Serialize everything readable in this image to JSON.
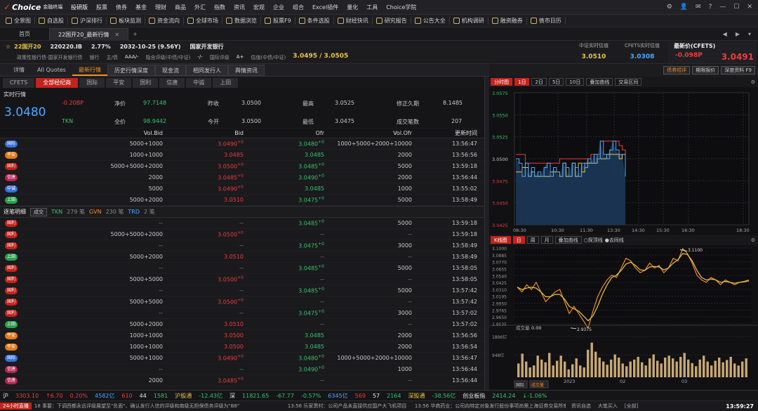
{
  "app": {
    "logo_mark": "✓",
    "logo_text": "Choice",
    "logo_sub": "金融终端",
    "edition": "投研版"
  },
  "menu": [
    "股票",
    "债券",
    "基金",
    "理财",
    "商品",
    "外汇",
    "指数",
    "资讯",
    "宏观",
    "企业",
    "组合",
    "Excel插件",
    "量化",
    "工具",
    "Choice学院"
  ],
  "toolbar": [
    "全景图",
    "自选股",
    "沪深排行",
    "板块监测",
    "资金流向",
    "全球市场",
    "数据浏览",
    "股票F9",
    "条件选股",
    "财经快讯",
    "研究报告",
    "公告大全",
    "机构调研",
    "融资融券",
    "债市日历"
  ],
  "tabs": {
    "home": "首页",
    "active": "22国开20_最新行情"
  },
  "bond": {
    "name": "22国开20",
    "code": "220220.IB",
    "coupon": "2.77%",
    "maturity": "2032-10-25 (9.56Y)",
    "issuer": "国家开发银行",
    "attr1": "政策性银行债-国家开发银行债",
    "attr2": "银行",
    "attr3": "主/债",
    "attr4": "AAA/-",
    "attr5": "隐含评级(中债/中证)",
    "attr6": "-/-",
    "attr7": "国际评级",
    "attr8": "A+",
    "val_label": "估值(中债/中证)",
    "val": "3.0495 / 3.0505"
  },
  "quotes": [
    {
      "label": "中证实时估值",
      "value": "3.0510"
    },
    {
      "label": "CFETS实时估值",
      "value": "3.0308"
    },
    {
      "label": "最新价(CFETS)",
      "value": "-0.098P",
      "value2": "3.0491"
    }
  ],
  "subtabs": [
    "详情",
    "All Quotes",
    "最新行情",
    "历史行情深度",
    "现金流",
    "相同发行人",
    "舆情资讯"
  ],
  "rightbtns": [
    "债券短评",
    "期限报价",
    "深度资料 F9"
  ],
  "sources": [
    "CFETS",
    "全部经纪商",
    "国际",
    "平安",
    "国利",
    "信唐",
    "中诚",
    "上田"
  ],
  "live": {
    "label": "实时行情",
    "last": "3.0480",
    "chg": "-0.20BP",
    "tkn": "TKN",
    "kv": [
      {
        "k": "净价",
        "v": "97.7148"
      },
      {
        "k": "昨收",
        "v": "3.0500"
      },
      {
        "k": "最高",
        "v": "3.0525"
      },
      {
        "k": "修正久期",
        "v": "8.1485"
      },
      {
        "k": "全价",
        "v": "98.9442"
      },
      {
        "k": "今开",
        "v": "3.0500"
      },
      {
        "k": "最低",
        "v": "3.0475"
      },
      {
        "k": "成交笔数",
        "v": "207"
      }
    ]
  },
  "book_cols": [
    "Vol.Bid",
    "Bid",
    "Ofr",
    "Vol.Ofr",
    "更新时间"
  ],
  "book": [
    {
      "src": "国际",
      "vb": "5000+1000",
      "b": "3.0490",
      "bc": "+0",
      "o": "3.0480",
      "oc": "+0",
      "vo": "1000+5000+2000+10000",
      "t": "13:56:47",
      "color": "#3a6fd8"
    },
    {
      "src": "平安",
      "vb": "1000+1000",
      "b": "3.0485",
      "bc": "",
      "o": "3.0485",
      "oc": "",
      "vo": "2000",
      "t": "13:56:56",
      "color": "#e07b1c"
    },
    {
      "src": "国利",
      "vb": "5000+5000+2000",
      "b": "3.0500",
      "bc": "+0",
      "o": "3.0485",
      "oc": "+0",
      "vo": "5000",
      "t": "13:59:18",
      "color": "#c2231b"
    },
    {
      "src": "信唐",
      "vb": "2000",
      "b": "3.0485",
      "bc": "+0",
      "o": "3.0490",
      "oc": "+0",
      "vo": "2000",
      "t": "13:56:44",
      "color": "#b0264f"
    },
    {
      "src": "中诚",
      "vb": "5000",
      "b": "3.0490",
      "bc": "+0",
      "o": "3.0485",
      "oc": "",
      "vo": "1000",
      "t": "13:55:02",
      "color": "#3a6fd8"
    },
    {
      "src": "上田",
      "vb": "5000+2000",
      "b": "3.0510",
      "bc": "",
      "o": "3.0475",
      "oc": "+0",
      "vo": "5000",
      "t": "13:58:49",
      "color": "#2e9e4e"
    }
  ],
  "trades_hdr": {
    "title": "逐笔明细",
    "btn": "成交",
    "tkn": "TKN",
    "tkn_n": "279 笔",
    "gvn": "GVN",
    "gvn_n": "230 笔",
    "trd": "TRD",
    "trd_n": "2 笔"
  },
  "trades": [
    {
      "src": "国利",
      "vb": "--",
      "b": "--",
      "o": "3.0485",
      "oc": "+0",
      "vo": "5000",
      "t": "13:59:18",
      "color": "#c2231b"
    },
    {
      "src": "国利",
      "vb": "5000+5000+2000",
      "b": "3.0500",
      "bc": "+0",
      "o": "--",
      "vo": "--",
      "t": "13:59:18",
      "color": "#c2231b"
    },
    {
      "src": "国利",
      "vb": "--",
      "b": "--",
      "o": "3.0475",
      "oc": "+0",
      "vo": "3000",
      "t": "13:58:49",
      "color": "#c2231b"
    },
    {
      "src": "上田",
      "vb": "5000+2000",
      "b": "3.0510",
      "bc": "",
      "o": "--",
      "vo": "--",
      "t": "13:58:49",
      "color": "#2e9e4e"
    },
    {
      "src": "国利",
      "vb": "--",
      "b": "--",
      "o": "3.0485",
      "oc": "+0",
      "vo": "5000",
      "t": "13:58:05",
      "color": "#c2231b"
    },
    {
      "src": "国利",
      "vb": "5000+5000",
      "b": "3.0500",
      "bc": "+0",
      "o": "--",
      "vo": "--",
      "t": "13:58:05",
      "color": "#c2231b"
    },
    {
      "src": "国利",
      "vb": "--",
      "b": "--",
      "o": "3.0485",
      "oc": "+0",
      "vo": "5000",
      "t": "13:57:42",
      "color": "#c2231b"
    },
    {
      "src": "国利",
      "vb": "5000+5000",
      "b": "3.0500",
      "bc": "+0",
      "o": "--",
      "vo": "--",
      "t": "13:57:42",
      "color": "#c2231b"
    },
    {
      "src": "国利",
      "vb": "--",
      "b": "--",
      "o": "3.0475",
      "oc": "+0",
      "vo": "3000",
      "t": "13:57:02",
      "color": "#c2231b"
    },
    {
      "src": "上田",
      "vb": "5000+2000",
      "b": "3.0510",
      "bc": "",
      "o": "--",
      "vo": "--",
      "t": "13:57:02",
      "color": "#2e9e4e"
    },
    {
      "src": "平安",
      "vb": "1000+1000",
      "b": "3.0500",
      "bc": "",
      "o": "3.0485",
      "oc": "",
      "vo": "2000",
      "t": "13:56:56",
      "color": "#e07b1c"
    },
    {
      "src": "平安",
      "vb": "1000+1000",
      "b": "3.0500",
      "bc": "",
      "o": "3.0485",
      "oc": "",
      "vo": "2000",
      "t": "13:56:54",
      "color": "#e07b1c"
    },
    {
      "src": "国际",
      "vb": "5000+1000",
      "b": "3.0490",
      "bc": "+0",
      "o": "3.0480",
      "oc": "+0",
      "vo": "1000+5000+2000+10000",
      "t": "13:56:47",
      "color": "#3a6fd8"
    },
    {
      "src": "信唐",
      "vb": "--",
      "b": "--",
      "o": "3.0490",
      "oc": "+0",
      "vo": "1000",
      "t": "13:56:44",
      "color": "#b0264f"
    },
    {
      "src": "信唐",
      "vb": "2000",
      "b": "3.0485",
      "bc": "+0",
      "o": "--",
      "vo": "--",
      "t": "13:56:44",
      "color": "#b0264f"
    }
  ],
  "intraday_bar": {
    "title": "分时图",
    "periods": [
      "1日",
      "2日",
      "5日",
      "10日"
    ],
    "overlay": "叠加曲线",
    "deal": "交易区间"
  },
  "kline_bar": {
    "title": "K线图",
    "periods": [
      "日",
      "周",
      "月"
    ],
    "overlay": "叠加曲线",
    "opt1": "探顶线",
    "opt2": "去同线"
  },
  "volume_label": "成交量",
  "volume_value": "0.00",
  "vol_bottom": [
    "国际",
    "成交量"
  ],
  "chart_data": [
    {
      "type": "line",
      "title": "分时图",
      "y_ticks": [
        "3.0575",
        "3.0550",
        "3.0525",
        "3.0500",
        "3.0475",
        "3.0450",
        "3.0425"
      ],
      "ylim": [
        3.0425,
        3.0575
      ],
      "x_ticks": [
        "08:30",
        "10:30",
        "11:30",
        "13:30",
        "14:30",
        "15:30",
        "16:30",
        "18:30"
      ],
      "series": [
        {
          "color": "#ef3b3b",
          "values": [
            3.0505,
            3.0505,
            3.0505,
            3.0495,
            3.0495,
            3.0495,
            3.0495,
            3.0495,
            3.0495,
            3.0495,
            3.0495,
            3.0495,
            3.0495,
            3.0495,
            3.05,
            3.05,
            3.05,
            3.05,
            3.05,
            3.05,
            3.05,
            3.05,
            3.05,
            3.05,
            3.0505,
            3.0505,
            3.0505,
            3.052,
            3.052,
            3.052,
            3.052,
            3.052,
            3.052,
            3.0515,
            3.051,
            3.049
          ]
        },
        {
          "color": "#e8c44a",
          "values": [
            3.0485,
            3.0485,
            3.049,
            3.049,
            3.048,
            3.0485,
            3.048,
            3.048,
            3.048,
            3.048,
            3.048,
            3.0485,
            3.0485,
            3.0485,
            3.048,
            3.0495,
            3.048,
            3.048,
            3.0495,
            3.048,
            3.0495,
            3.0485,
            3.0495,
            3.0495,
            3.0495,
            3.0495,
            3.05,
            3.05,
            3.05,
            3.0505,
            3.0505,
            3.0505,
            3.0505,
            3.05,
            3.0505,
            3.049
          ]
        },
        {
          "color": "#4aa8ff",
          "values": [
            3.05,
            3.0495,
            3.048,
            3.0495,
            3.048,
            3.049,
            3.048,
            3.0485,
            3.048,
            3.049,
            3.0495,
            3.048,
            3.049,
            3.0485,
            3.048,
            3.0495,
            3.049,
            3.048,
            3.0495,
            3.049,
            3.048,
            3.0495,
            3.049,
            3.05,
            3.0495,
            3.0505,
            3.05,
            3.052,
            3.0505,
            3.05,
            3.051,
            3.052,
            3.051,
            3.0505,
            3.0505,
            3.048
          ]
        }
      ]
    },
    {
      "type": "line",
      "title": "K线图",
      "y_ticks": [
        "3.1000",
        "3.0885",
        "3.0770",
        "3.0655",
        "3.0540",
        "3.0425",
        "3.0310",
        "3.0195",
        "2.9950",
        "2.9765",
        "2.9650",
        "2.9535"
      ],
      "ylim": [
        2.9535,
        3.1115
      ],
      "x_ticks": [
        "2023",
        "02",
        "03"
      ],
      "annotations": [
        "3.1100",
        "2.9375"
      ],
      "series": [
        {
          "color": "#f08a24",
          "values": [
            3.03,
            3.02,
            3.035,
            3.025,
            3.04,
            3.02,
            3.0,
            3.01,
            3.02,
            3.025,
            3.0,
            2.975,
            2.99,
            2.975,
            2.96,
            2.945,
            2.98,
            3.01,
            3.03,
            3.045,
            3.055,
            3.05,
            3.07,
            3.09,
            3.085,
            3.07,
            3.06,
            3.065,
            3.08,
            3.07,
            3.075,
            3.06,
            3.07,
            3.09,
            3.085,
            3.11,
            3.1,
            3.08,
            3.055,
            3.045,
            3.04,
            3.05,
            3.045,
            3.035,
            3.045,
            3.04,
            3.035,
            3.04,
            3.042,
            3.045
          ]
        },
        {
          "color": "#e8c44a",
          "values": [
            3.03,
            3.025,
            3.028,
            3.03,
            3.028,
            3.02,
            3.01,
            3.01,
            3.015,
            3.015,
            3.005,
            2.99,
            2.985,
            2.98,
            2.97,
            2.96,
            2.97,
            2.99,
            3.015,
            3.035,
            3.05,
            3.055,
            3.065,
            3.078,
            3.082,
            3.075,
            3.066,
            3.065,
            3.072,
            3.073,
            3.072,
            3.066,
            3.07,
            3.08,
            3.087,
            3.1,
            3.098,
            3.085,
            3.065,
            3.05,
            3.045,
            3.047,
            3.045,
            3.04,
            3.042,
            3.04,
            3.038,
            3.04,
            3.041,
            3.043
          ]
        }
      ]
    },
    {
      "type": "bar",
      "title": "成交量",
      "y_ticks": [
        "1896亿",
        "948亿"
      ],
      "values": [
        0.35,
        0.6,
        0.4,
        0.25,
        0.3,
        0.55,
        0.45,
        0.38,
        0.62,
        0.3,
        0.42,
        0.55,
        0.4,
        0.2,
        0.33,
        0.48,
        0.3,
        0.25,
        0.7,
        0.88,
        0.65,
        0.5,
        0.4,
        0.32,
        0.45,
        0.58,
        0.5,
        0.35,
        0.28,
        0.4,
        0.45,
        0.52,
        0.38,
        0.3,
        0.48,
        0.58,
        0.42,
        0.35,
        0.5,
        0.55,
        0.48,
        0.4,
        0.52,
        0.62,
        0.45,
        0.36,
        0.28,
        0.45,
        0.55,
        0.4,
        0.3,
        0.42,
        0.5,
        0.38,
        0.44,
        0.52,
        0.35,
        0.3,
        0.4,
        0.48
      ]
    }
  ],
  "status": [
    {
      "t": "沪",
      "c": "white"
    },
    {
      "t": "3303.10",
      "c": "red"
    },
    {
      "t": "↑6.70",
      "c": "red"
    },
    {
      "t": "0.20%",
      "c": "red"
    },
    {
      "t": "4582亿",
      "c": "blue"
    },
    {
      "t": "610",
      "c": "red"
    },
    {
      "t": "44",
      "c": "white"
    },
    {
      "t": "1581",
      "c": "green"
    },
    {
      "t": "沪股通",
      "c": "yellow"
    },
    {
      "t": "-12.43亿",
      "c": "green"
    },
    {
      "t": "深",
      "c": "white"
    },
    {
      "t": "11821.65",
      "c": "green"
    },
    {
      "t": "-67.77",
      "c": "green"
    },
    {
      "t": "-0.57%",
      "c": "green"
    },
    {
      "t": "6345亿",
      "c": "blue"
    },
    {
      "t": "569",
      "c": "red"
    },
    {
      "t": "57",
      "c": "white"
    },
    {
      "t": "2164",
      "c": "green"
    },
    {
      "t": "深股通",
      "c": "yellow"
    },
    {
      "t": "-38.56亿",
      "c": "green"
    },
    {
      "t": "创业板指",
      "c": "white"
    },
    {
      "t": "2414.24",
      "c": "green"
    },
    {
      "t": "↓-1.06%",
      "c": "green"
    }
  ],
  "news": {
    "live": "24小时直播",
    "items": [
      "18 事要：下调西都永远评级展望至\"负面\"、确认发行人信的评级和南级无担保债务评级为\"B8\"",
      "13:56 乐家萧村：公司产品未直接供应国产大飞机项目",
      "13:56 华商药业：公司向特定对象发行股份事项尚需上海证券交易所审核",
      "资讯自选",
      "大笔买入",
      "[全部]"
    ],
    "clock": "13:59:27"
  }
}
